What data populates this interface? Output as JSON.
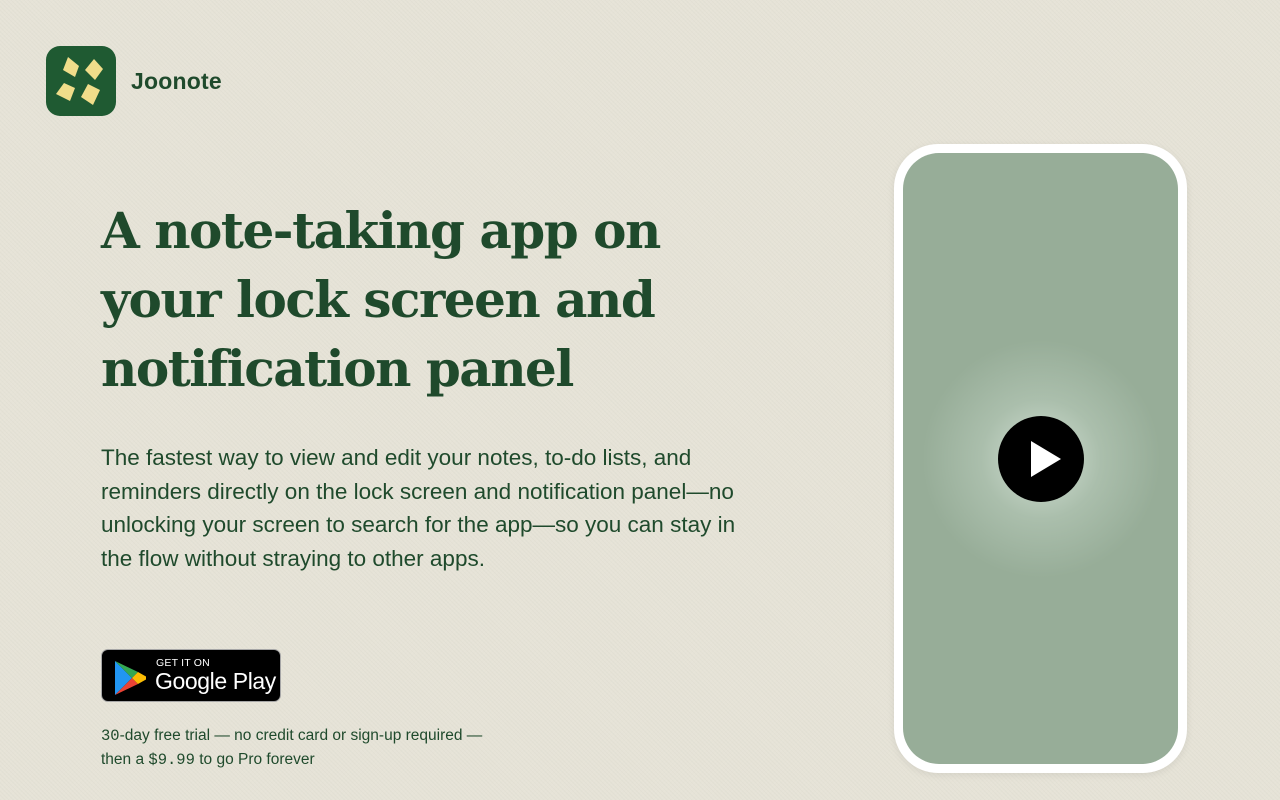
{
  "brand": {
    "name": "Joonote",
    "logo_icon": "four-diamonds-logo-icon",
    "logo_bg_color": "#1f5a32",
    "logo_fg_color": "#f0dd8a"
  },
  "hero": {
    "headline": "A note-taking app on your lock screen and notification panel",
    "description": "The fastest way to view and edit your notes, to-do lists, and reminders directly on the lock screen and notification panel—no unlocking your screen to search for the app—so you can stay in the flow without straying to other apps."
  },
  "store_badge": {
    "small_text": "GET IT ON",
    "big_text": "Google Play",
    "icon": "google-play-icon"
  },
  "trial": {
    "days": "30",
    "part1": "-day free trial — no credit card or sign-up required —",
    "part2": "then a ",
    "price": "$9.99",
    "part3": " to go Pro forever"
  },
  "video": {
    "icon": "play-icon"
  },
  "colors": {
    "background": "#e6e3d7",
    "text_green": "#1f4a2c",
    "phone_screen": "#97ad98"
  }
}
